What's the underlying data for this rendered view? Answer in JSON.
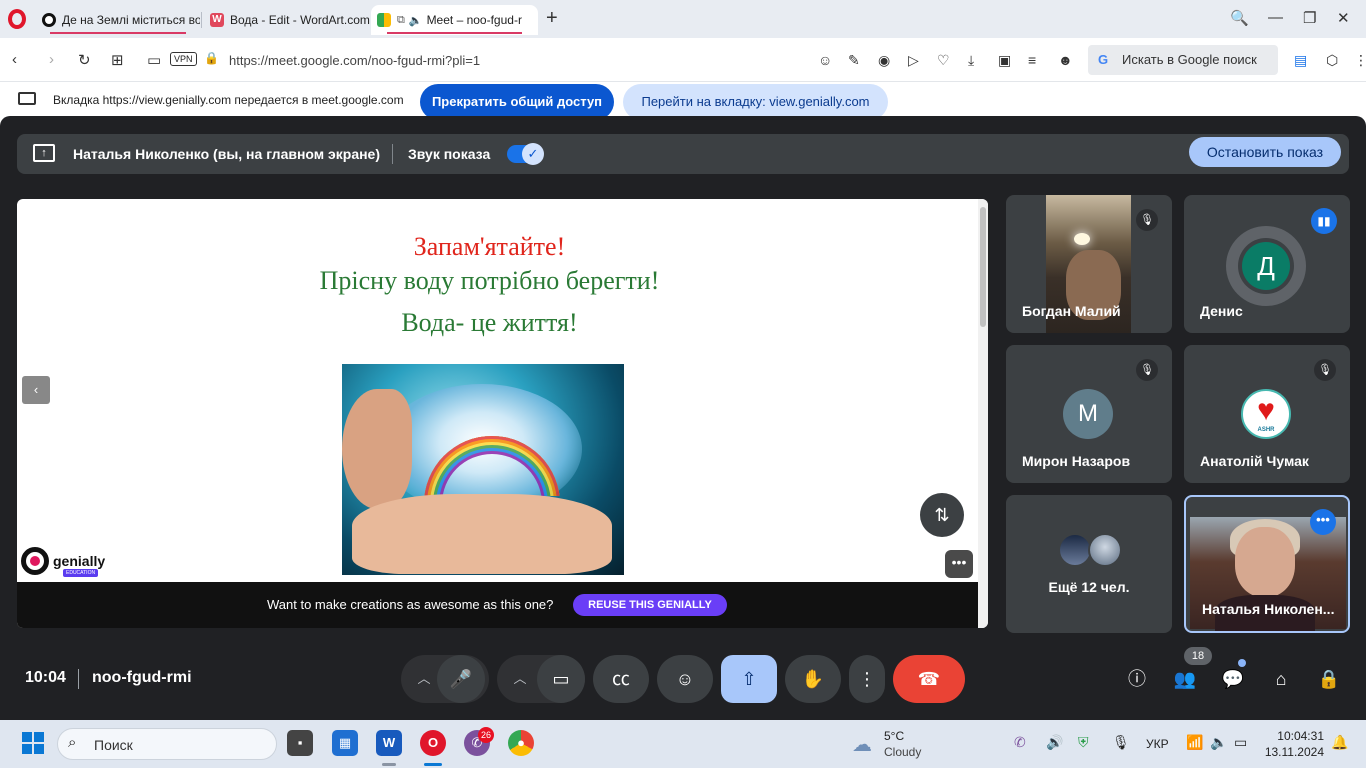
{
  "browser": {
    "tabs": [
      {
        "title": "Де на Землі міститься вод"
      },
      {
        "title": "Вода - Edit - WordArt.com",
        "favicon_letter": "W"
      },
      {
        "title": "Meet – noo-fgud-r"
      }
    ],
    "new_tab": "+",
    "url": "https://meet.google.com/noo-fgud-rmi?pli=1",
    "vpn_label": "VPN",
    "search_placeholder": "Искать в Google поиск",
    "search_g": "G"
  },
  "share_notice": {
    "text": "Вкладка https://view.genially.com передается в meet.google.com",
    "stop_button": "Прекратить общий доступ",
    "goto_button": "Перейти на вкладку: view.genially.com"
  },
  "presentation_bar": {
    "presenter": "Наталья Николенко (вы, на главном экране)",
    "sound_label": "Звук показа",
    "sound_enabled": true,
    "stop_button": "Остановить показ"
  },
  "slide": {
    "line1": "Запам'ятайте!",
    "line2": "Прісну воду потрібно берегти!",
    "line3": "Вода- це  життя!",
    "genially_logo": "genially",
    "genially_badge": "EDUCATION",
    "promo_text": "Want to make creations as awesome as this one?",
    "promo_button": "REUSE THIS GENIALLY",
    "more": "•••",
    "prev": "‹"
  },
  "participants": [
    {
      "name": "Богдан Малий",
      "muted": true
    },
    {
      "name": "Денис",
      "initial": "Д",
      "speaking": true
    },
    {
      "name": "Мирон Назаров",
      "initial": "М",
      "muted": true
    },
    {
      "name": "Анатолій Чумак",
      "avatar_text": "ASHR",
      "muted": true
    },
    {
      "name": "Ещё 12 чел."
    },
    {
      "name": "Наталья Николен..."
    }
  ],
  "controls": {
    "time": "10:04",
    "meeting_code": "noo-fgud-rmi",
    "people_count": "18"
  },
  "taskbar": {
    "search": "Поиск",
    "viber_badge": "26",
    "weather_temp": "5°C",
    "weather_desc": "Cloudy",
    "language": "УКР",
    "time": "10:04:31",
    "date": "13.11.2024"
  },
  "colors": {
    "meet_bg": "#202124",
    "accent_blue": "#0b57d0",
    "hangup_red": "#ea4335",
    "slide_red": "#e0251c",
    "slide_green": "#2a7a35"
  }
}
